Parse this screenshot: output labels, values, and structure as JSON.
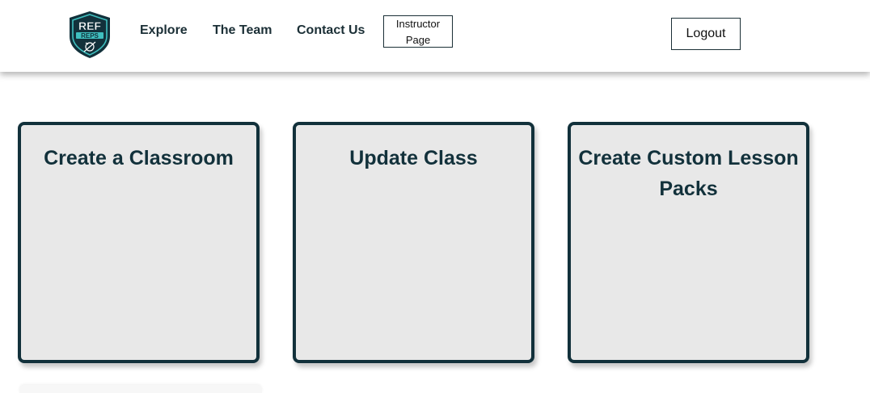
{
  "brand": {
    "logo_text_top": "REF",
    "logo_text_bottom": "REPS",
    "colors": {
      "dark": "#12313b",
      "teal": "#3fbfbf"
    }
  },
  "nav": {
    "explore": "Explore",
    "team": "The Team",
    "contact": "Contact Us",
    "instructor_line1": "Instructor",
    "instructor_line2": "Page"
  },
  "header": {
    "logout": "Logout"
  },
  "cards": [
    {
      "title": "Create a Classroom"
    },
    {
      "title": "Update Class"
    },
    {
      "title": "Create Custom Lesson Packs"
    }
  ]
}
